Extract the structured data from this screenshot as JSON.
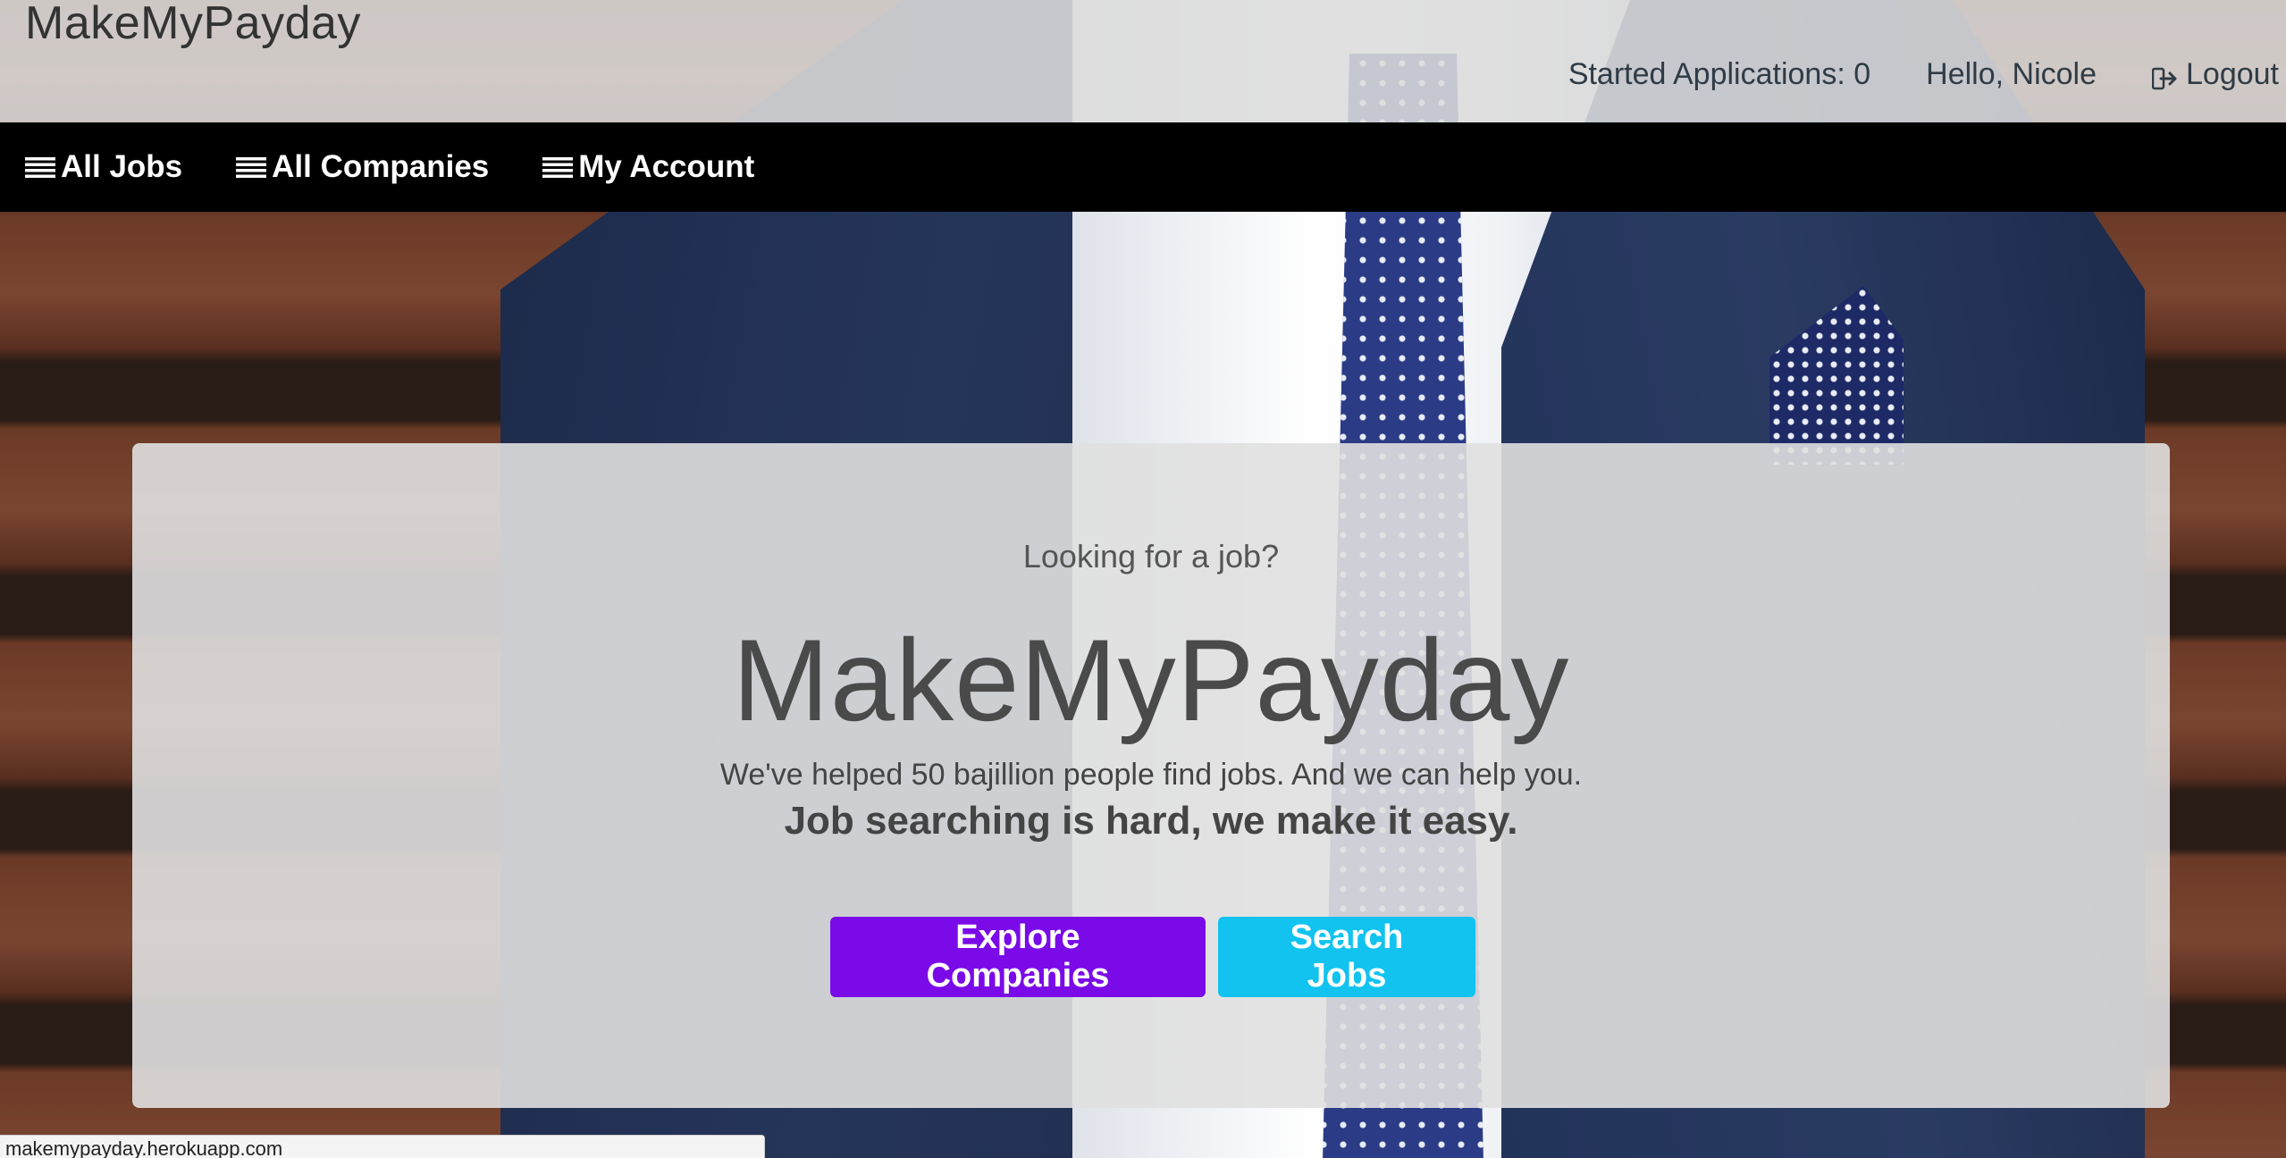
{
  "header": {
    "brand": "MakeMyPayday",
    "started_applications": "Started Applications: 0",
    "greeting": "Hello, Nicole",
    "logout_label": "Logout"
  },
  "nav": {
    "items": [
      {
        "label": "All Jobs",
        "icon": "list-icon"
      },
      {
        "label": "All Companies",
        "icon": "list-icon"
      },
      {
        "label": "My Account",
        "icon": "list-icon"
      }
    ]
  },
  "hero": {
    "eyebrow": "Looking for a job?",
    "title": "MakeMyPayday",
    "tagline": "We've helped 50 bajillion people find jobs. And we can help you.",
    "tagline_strong": "Job searching is hard, we make it easy.",
    "explore_button": "Explore Companies",
    "search_button": "Search Jobs"
  },
  "statusbar": {
    "url": "makemypayday.herokuapp.com"
  },
  "colors": {
    "nav_background": "#000000",
    "explore_button": "#7a0be8",
    "search_button": "#12c3ef"
  }
}
